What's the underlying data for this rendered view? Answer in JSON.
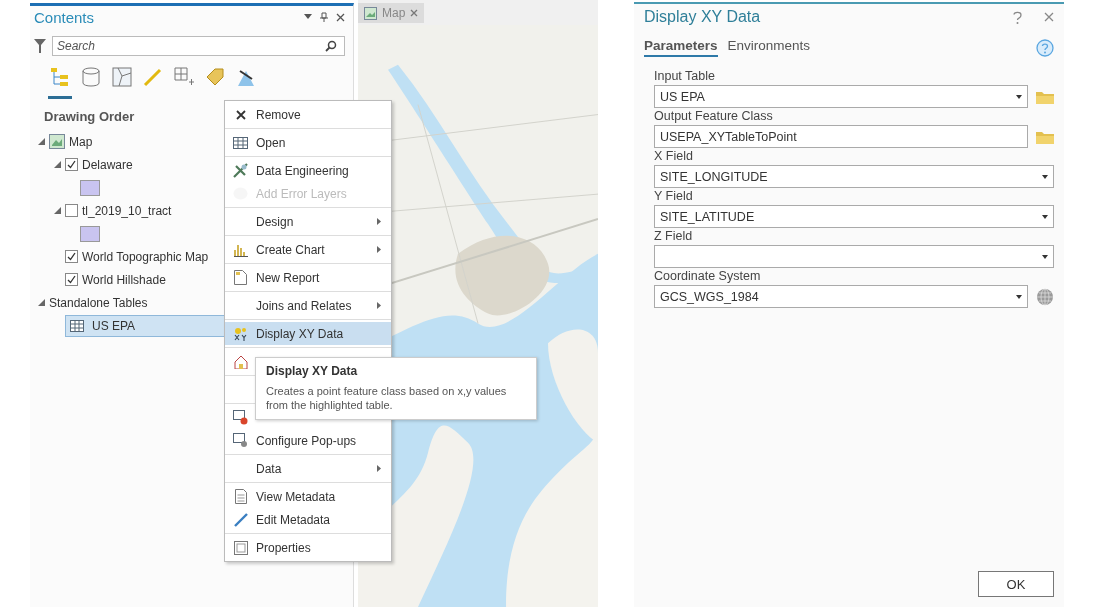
{
  "contents": {
    "title": "Contents",
    "search": {
      "placeholder": "Search"
    },
    "toolbar": [
      {
        "kind": "tree",
        "selected": true
      },
      {
        "kind": "db",
        "selected": false
      },
      {
        "kind": "source",
        "selected": false
      },
      {
        "kind": "pencil",
        "selected": false
      },
      {
        "kind": "grid",
        "selected": false
      },
      {
        "kind": "label",
        "selected": false
      },
      {
        "kind": "snap",
        "selected": false
      }
    ],
    "heading": "Drawing Order",
    "tree": [
      {
        "label": "Map",
        "kind": "map",
        "expanded": true,
        "selected": false,
        "children": [
          {
            "label": "Delaware",
            "kind": "layer",
            "checked": true,
            "expanded": true,
            "selected": false,
            "color": "#c9c4f0"
          },
          {
            "label": "tl_2019_10_tract",
            "kind": "layer",
            "checked": false,
            "expanded": true,
            "selected": false,
            "color": "#c9c4f0"
          },
          {
            "label": "World Topographic Map",
            "kind": "layer",
            "checked": true,
            "selected": false
          },
          {
            "label": "World Hillshade",
            "kind": "layer",
            "checked": true,
            "selected": false
          }
        ]
      },
      {
        "label": "Standalone Tables",
        "kind": "group",
        "expanded": true,
        "selected": false,
        "children": [
          {
            "label": "US EPA",
            "kind": "table",
            "selected": true
          }
        ]
      }
    ]
  },
  "map_tab": {
    "label": "Map"
  },
  "context_menu": [
    [
      {
        "label": "Remove",
        "kind": "remove",
        "disabled": false,
        "submenu": false,
        "selected": false
      }
    ],
    [
      {
        "label": "Open",
        "kind": "table",
        "disabled": false,
        "submenu": false,
        "selected": false
      }
    ],
    [
      {
        "label": "Data Engineering",
        "kind": "engineering",
        "disabled": false,
        "submenu": false,
        "selected": false
      },
      {
        "label": "Add Error Layers",
        "kind": "error",
        "disabled": true,
        "submenu": false,
        "selected": false
      }
    ],
    [
      {
        "label": "Design",
        "kind": "none",
        "disabled": false,
        "submenu": true,
        "selected": false
      }
    ],
    [
      {
        "label": "Create Chart",
        "kind": "chart",
        "disabled": false,
        "submenu": true,
        "selected": false
      }
    ],
    [
      {
        "label": "New Report",
        "kind": "report",
        "disabled": false,
        "submenu": false,
        "selected": false
      }
    ],
    [
      {
        "label": "Joins and Relates",
        "kind": "none",
        "disabled": false,
        "submenu": true,
        "selected": false
      }
    ],
    [
      {
        "label": "Display XY Data",
        "kind": "xy",
        "disabled": false,
        "submenu": false,
        "selected": true
      }
    ],
    [
      {
        "kind": "house",
        "disabled": false,
        "selected": false
      }
    ],
    [
      {
        "kind": "none",
        "selected": false
      }
    ],
    [
      {
        "kind": "popup-off",
        "disabled": false,
        "selected": false
      },
      {
        "label": "Configure Pop-ups",
        "kind": "popup",
        "disabled": false,
        "submenu": false,
        "selected": false
      }
    ],
    [
      {
        "label": "Data",
        "kind": "none",
        "disabled": false,
        "submenu": true,
        "selected": false
      }
    ],
    [
      {
        "label": "View Metadata",
        "kind": "metadata",
        "disabled": false,
        "submenu": false,
        "selected": false
      },
      {
        "label": "Edit Metadata",
        "kind": "edit",
        "disabled": false,
        "submenu": false,
        "selected": false
      }
    ],
    [
      {
        "label": "Properties",
        "kind": "properties",
        "disabled": false,
        "submenu": false,
        "selected": false
      }
    ]
  ],
  "tooltip": {
    "title": "Display XY Data",
    "text": "Creates a point feature class based on x,y values from the highlighted table."
  },
  "dialog": {
    "title": "Display XY Data",
    "tabs": [
      {
        "label": "Parameters",
        "selected": true
      },
      {
        "label": "Environments",
        "selected": false
      }
    ],
    "fields": [
      {
        "label": "Input Table",
        "value": "US EPA",
        "dropdown": true,
        "kind": "dataset"
      },
      {
        "label": "Output Feature Class",
        "value": "USEPA_XYTableToPoint",
        "dropdown": false,
        "kind": "dataset"
      },
      {
        "label": "X Field",
        "value": "SITE_LONGITUDE",
        "dropdown": true,
        "kind": "field"
      },
      {
        "label": "Y Field",
        "value": "SITE_LATITUDE",
        "dropdown": true,
        "kind": "field"
      },
      {
        "label": "Z Field",
        "dropdown": true,
        "kind": "field"
      },
      {
        "label": "Coordinate System",
        "value": "GCS_WGS_1984",
        "dropdown": true,
        "kind": "coordinate"
      }
    ],
    "ok": "OK"
  }
}
